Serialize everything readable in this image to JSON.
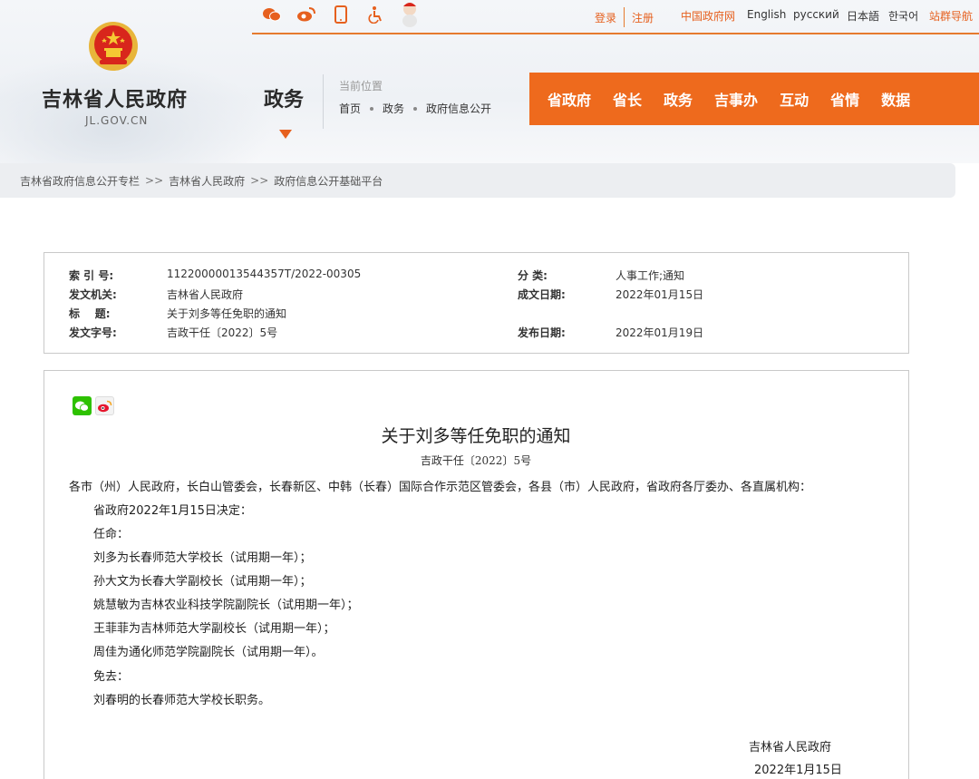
{
  "site": {
    "name": "吉林省人民政府",
    "domain": "JL.GOV.CN"
  },
  "top_bar": {
    "icons": [
      "weixin-icon",
      "weibo-icon",
      "mobile-icon",
      "accessibility-icon",
      "mascot-icon"
    ],
    "login": "登录",
    "register": "注册",
    "gov_link": "中国政府网",
    "english": "English",
    "russian": "русский",
    "japanese": "日本語",
    "korean": "한국어",
    "site_nav": "站群导航"
  },
  "section": {
    "title": "政务",
    "position_label": "当前位置",
    "crumbs": [
      "首页",
      "政务",
      "政府信息公开"
    ]
  },
  "main_nav": [
    "省政府",
    "省长",
    "政务",
    "吉事办",
    "互动",
    "省情",
    "数据"
  ],
  "breadcrumb": [
    "吉林省政府信息公开专栏",
    "吉林省人民政府",
    "政府信息公开基础平台"
  ],
  "breadcrumb_sep": ">>",
  "meta": {
    "index_label": "索 引 号:",
    "index_value": "11220000013544357T/2022-00305",
    "category_label": "分 类:",
    "category_value": "人事工作;通知",
    "issuer_label": "发文机关:",
    "issuer_value": "吉林省人民政府",
    "written_date_label": "成文日期:",
    "written_date_value": "2022年01月15日",
    "title_label": "标    题:",
    "title_value": "关于刘多等任免职的通知",
    "doc_no_label": "发文字号:",
    "doc_no_value": "吉政干任〔2022〕5号",
    "publish_date_label": "发布日期:",
    "publish_date_value": "2022年01月19日"
  },
  "document": {
    "title": "关于刘多等任免职的通知",
    "number": "吉政干任〔2022〕5号",
    "recipients": "各市（州）人民政府，长白山管委会，长春新区、中韩（长春）国际合作示范区管委会，各县（市）人民政府，省政府各厅委办、各直属机构：",
    "decision": "省政府2022年1月15日决定：",
    "appoint_label": "任命：",
    "appointments": [
      "刘多为长春师范大学校长（试用期一年）；",
      "孙大文为长春大学副校长（试用期一年）；",
      "姚慧敏为吉林农业科技学院副院长（试用期一年）；",
      "王菲菲为吉林师范大学副校长（试用期一年）；",
      "周佳为通化师范学院副院长（试用期一年）。"
    ],
    "dismiss_label": "免去：",
    "dismissals": [
      "刘春明的长春师范大学校长职务。"
    ],
    "signature": "吉林省人民政府",
    "date": "2022年1月15日"
  },
  "colors": {
    "accent": "#ee6a1d",
    "link_orange": "#e6601e"
  }
}
